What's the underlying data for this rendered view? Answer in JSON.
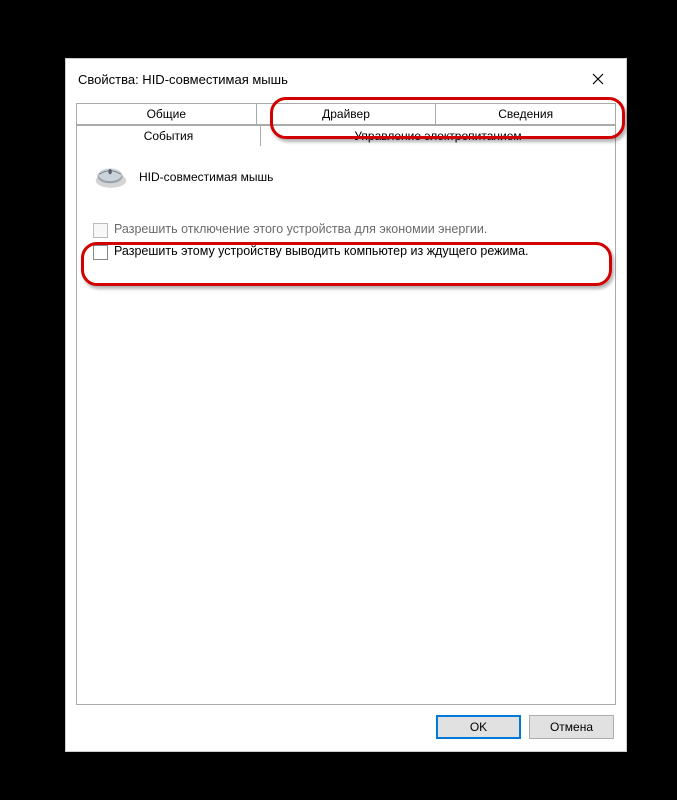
{
  "title": "Свойства: HID-совместимая мышь",
  "tabs": {
    "row1": [
      "Общие",
      "Драйвер",
      "Сведения"
    ],
    "row2": [
      "События",
      "Управление электропитанием"
    ]
  },
  "device_name": "HID-совместимая мышь",
  "options": {
    "opt1": "Разрешить отключение этого устройства для экономии энергии.",
    "opt2": "Разрешить этому устройству выводить компьютер из ждущего режима."
  },
  "buttons": {
    "ok": "OK",
    "cancel": "Отмена"
  }
}
